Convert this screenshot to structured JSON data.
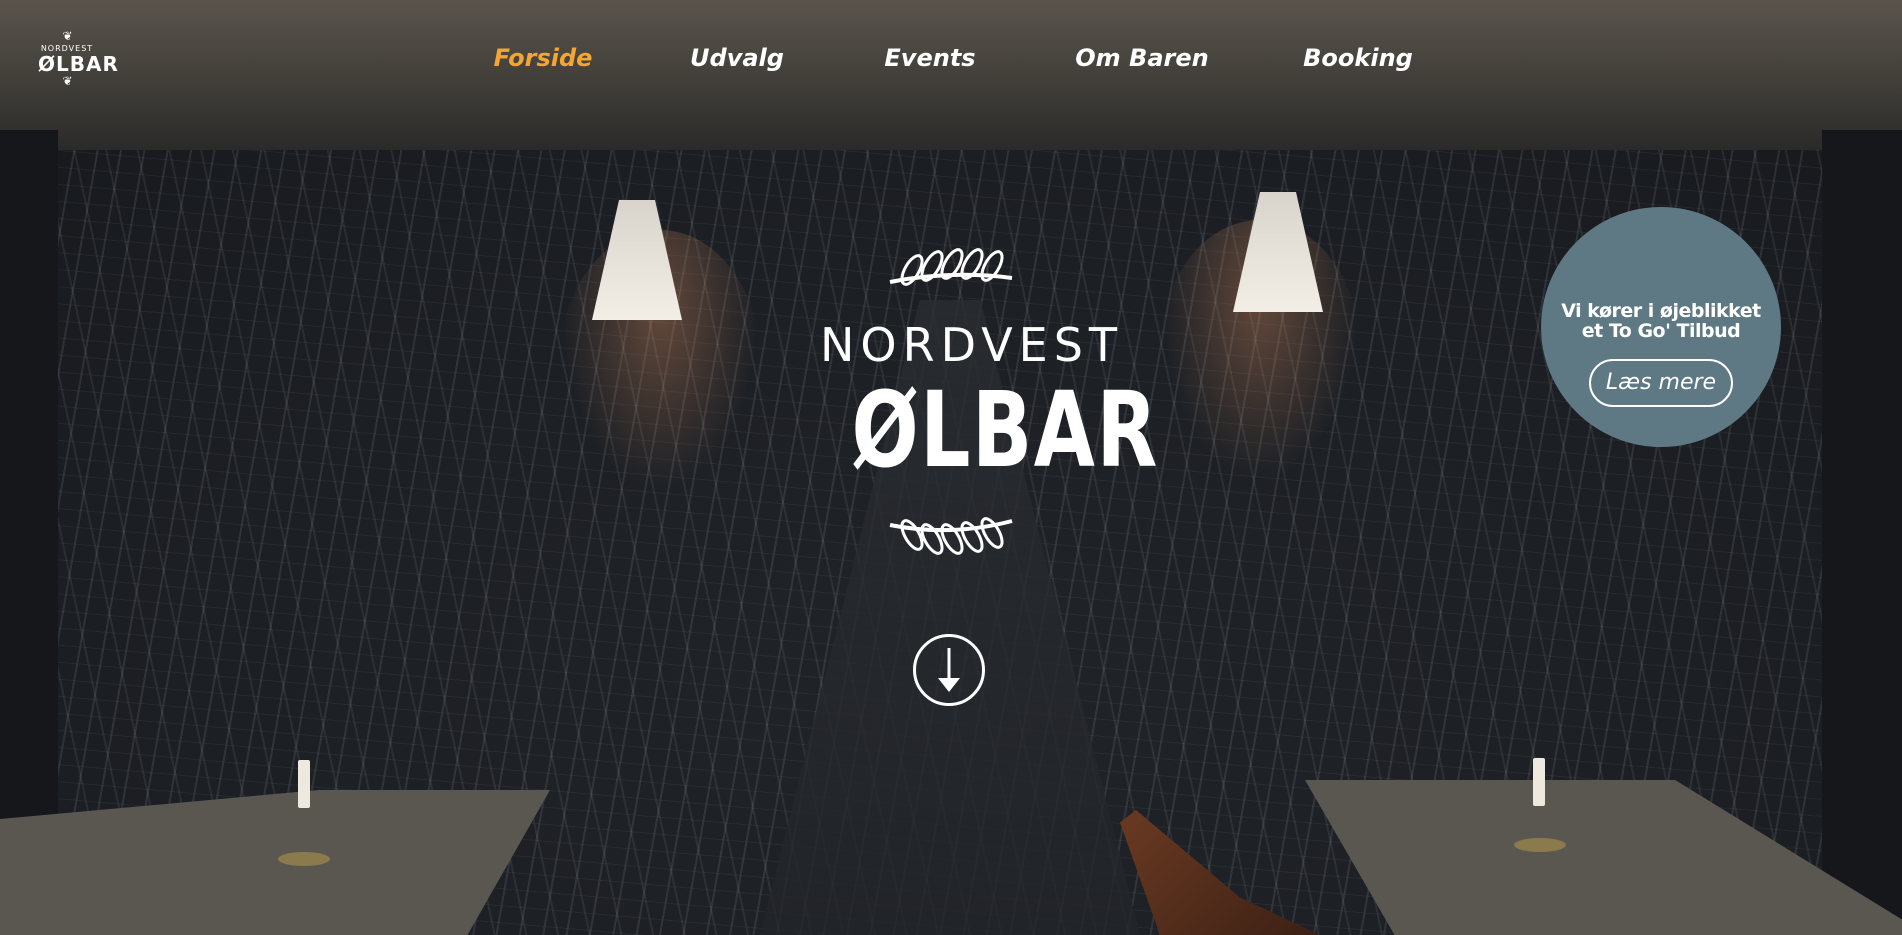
{
  "brand": {
    "small_top": "NORDVEST",
    "small_main": "ØLBAR",
    "hero_top": "NORDVEST",
    "hero_main": "ØLBAR"
  },
  "nav": {
    "items": [
      {
        "label": "Forside",
        "active": true
      },
      {
        "label": "Udvalg",
        "active": false
      },
      {
        "label": "Events",
        "active": false
      },
      {
        "label": "Om Baren",
        "active": false
      },
      {
        "label": "Booking",
        "active": false
      }
    ]
  },
  "promo": {
    "text": "Vi kører i øjeblikket et To Go' Tilbud",
    "button_label": "Læs mere"
  },
  "scroll": {
    "icon": "arrow-down-icon"
  },
  "colors": {
    "active_nav": "#f4a630",
    "promo_bg": "#5f7984",
    "text": "#ffffff"
  }
}
